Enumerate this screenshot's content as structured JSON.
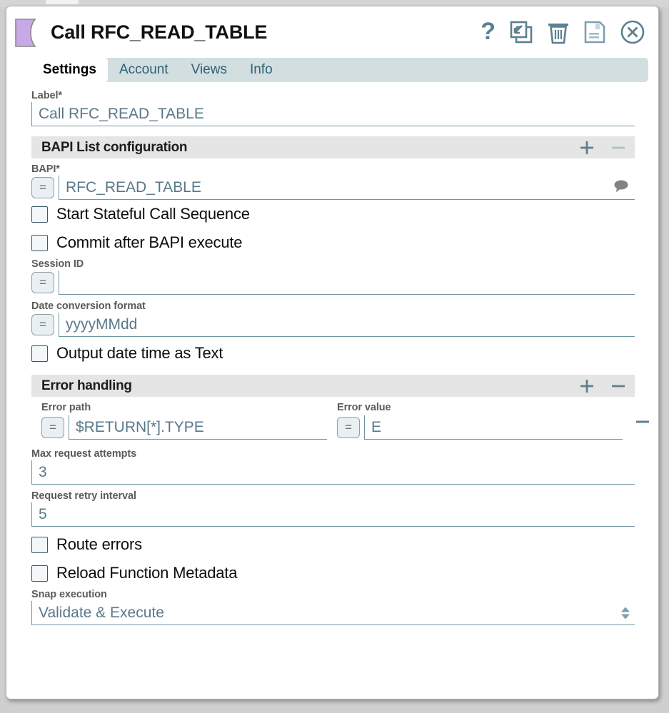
{
  "window": {
    "title": "Call RFC_READ_TABLE",
    "snap_icon": "snap-shape-icon",
    "snap_color": "#c9a8e8",
    "accent_color": "#5c7f91"
  },
  "title_actions": [
    {
      "name": "help-icon",
      "label": "?"
    },
    {
      "name": "duplicate-icon",
      "label": "Duplicate"
    },
    {
      "name": "delete-icon",
      "label": "Delete"
    },
    {
      "name": "save-icon",
      "label": "Save"
    },
    {
      "name": "close-icon",
      "label": "Close"
    }
  ],
  "tabs": [
    {
      "label": "Settings",
      "active": true
    },
    {
      "label": "Account",
      "active": false
    },
    {
      "label": "Views",
      "active": false
    },
    {
      "label": "Info",
      "active": false
    }
  ],
  "form": {
    "label_field": {
      "label": "Label*",
      "value": "Call RFC_READ_TABLE"
    },
    "bapi_section": {
      "title": "BAPI List configuration",
      "add_label": "+",
      "remove_label": "–"
    },
    "bapi_field": {
      "label": "BAPI*",
      "expression_toggle": "=",
      "value": "RFC_READ_TABLE",
      "comment_icon": "comment-icon"
    },
    "stateful_checkbox": {
      "label": "Start Stateful Call Sequence",
      "checked": false
    },
    "commit_checkbox": {
      "label": "Commit after BAPI execute",
      "checked": false
    },
    "session_id": {
      "label": "Session ID",
      "expression_toggle": "=",
      "value": ""
    },
    "date_format": {
      "label": "Date conversion format",
      "expression_toggle": "=",
      "value": "yyyyMMdd"
    },
    "output_datetime_checkbox": {
      "label": "Output date time as Text",
      "checked": false
    },
    "error_section": {
      "title": "Error handling",
      "add_label": "+",
      "remove_label": "–"
    },
    "error_path": {
      "label": "Error path",
      "expression_toggle": "=",
      "value": "$RETURN[*].TYPE"
    },
    "error_value": {
      "label": "Error value",
      "expression_toggle": "=",
      "value": "E",
      "remove_label": "–"
    },
    "max_attempts": {
      "label": "Max request attempts",
      "value": "3"
    },
    "retry_interval": {
      "label": "Request retry interval",
      "value": "5"
    },
    "route_errors_checkbox": {
      "label": "Route errors",
      "checked": false
    },
    "reload_metadata_checkbox": {
      "label": "Reload Function Metadata",
      "checked": false
    },
    "snap_execution": {
      "label": "Snap execution",
      "value": "Validate & Execute"
    }
  }
}
